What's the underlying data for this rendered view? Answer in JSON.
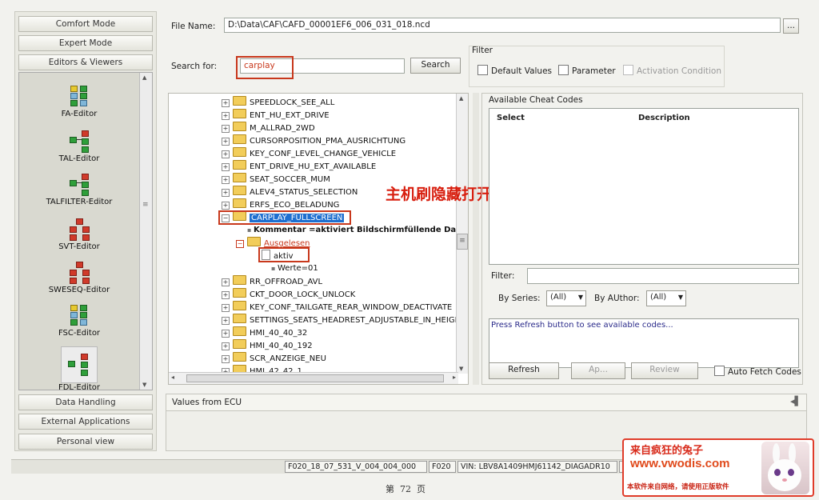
{
  "nav": {
    "comfort_mode": "Comfort Mode",
    "expert_mode": "Expert Mode",
    "editors_viewers": "Editors & Viewers",
    "data_handling": "Data Handling",
    "external_applications": "External Applications",
    "personal_view": "Personal view",
    "editors": [
      "FA-Editor",
      "TAL-Editor",
      "TALFILTER-Editor",
      "SVT-Editor",
      "SWESEQ-Editor",
      "FSC-Editor",
      "FDL-Editor"
    ]
  },
  "file": {
    "label": "File Name:",
    "value": "D:\\Data\\CAF\\CAFD_00001EF6_006_031_018.ncd",
    "browse": "..."
  },
  "search": {
    "label": "Search for:",
    "value": "carplay",
    "button": "Search"
  },
  "filter": {
    "title": "Filter",
    "default_values": "Default Values",
    "parameter": "Parameter",
    "activation_condition": "Activation Condition"
  },
  "tree": {
    "items": [
      "SPEEDLOCK_SEE_ALL",
      "ENT_HU_EXT_DRIVE",
      "M_ALLRAD_2WD",
      "CURSORPOSITION_PMA_AUSRICHTUNG",
      "KEY_CONF_LEVEL_CHANGE_VEHICLE",
      "ENT_DRIVE_HU_EXT_AVAILABLE",
      "SEAT_SOCCER_MUM",
      "ALEV4_STATUS_SELECTION",
      "ERFS_ECO_BELADUNG"
    ],
    "selected": "CARPLAY_FULLSCREEN",
    "kommentar": "Kommentar =aktiviert Bildschirmfüllende Darstellung",
    "ausgelesen": "Ausgelesen",
    "aktiv": "aktiv",
    "werte": "Werte=01",
    "items_after": [
      "RR_OFFROAD_AVL",
      "CKT_DOOR_LOCK_UNLOCK",
      "KEY_CONF_TAILGATE_REAR_WINDOW_DEACTIVATE",
      "SETTINGS_SEATS_HEADREST_ADJUSTABLE_IN_HEIGH",
      "HMI_40_40_32",
      "HMI_40_40_192",
      "SCR_ANZEIGE_NEU",
      "HMI_42_42_1"
    ]
  },
  "annotation": "主机刷隐藏打开这一项",
  "cheat": {
    "title": "Available Cheat Codes",
    "col_select": "Select",
    "col_description": "Description",
    "filter_label": "Filter:",
    "by_series": "By Series:",
    "series_value": "(All)",
    "by_author": "By AUthor:",
    "author_value": "(All)",
    "info": "Press Refresh button to see available codes...",
    "refresh": "Refresh",
    "ap": "Ap...",
    "review": "Review",
    "auto_fetch": "Auto Fetch Codes"
  },
  "ecu": {
    "title": "Values from ECU"
  },
  "status": {
    "cell1": "F020_18_07_531_V_004_004_000",
    "cell2": "F020",
    "cell3": "VIN: LBV8A1409HMJ61142_DIAGADR10",
    "cell4": "F"
  },
  "page_footer": "第  72  页",
  "watermark": {
    "line1": "来自疯狂的兔子",
    "line2": "www.vwodis.com",
    "line3": "本软件来自网络，请使用正版软件"
  }
}
